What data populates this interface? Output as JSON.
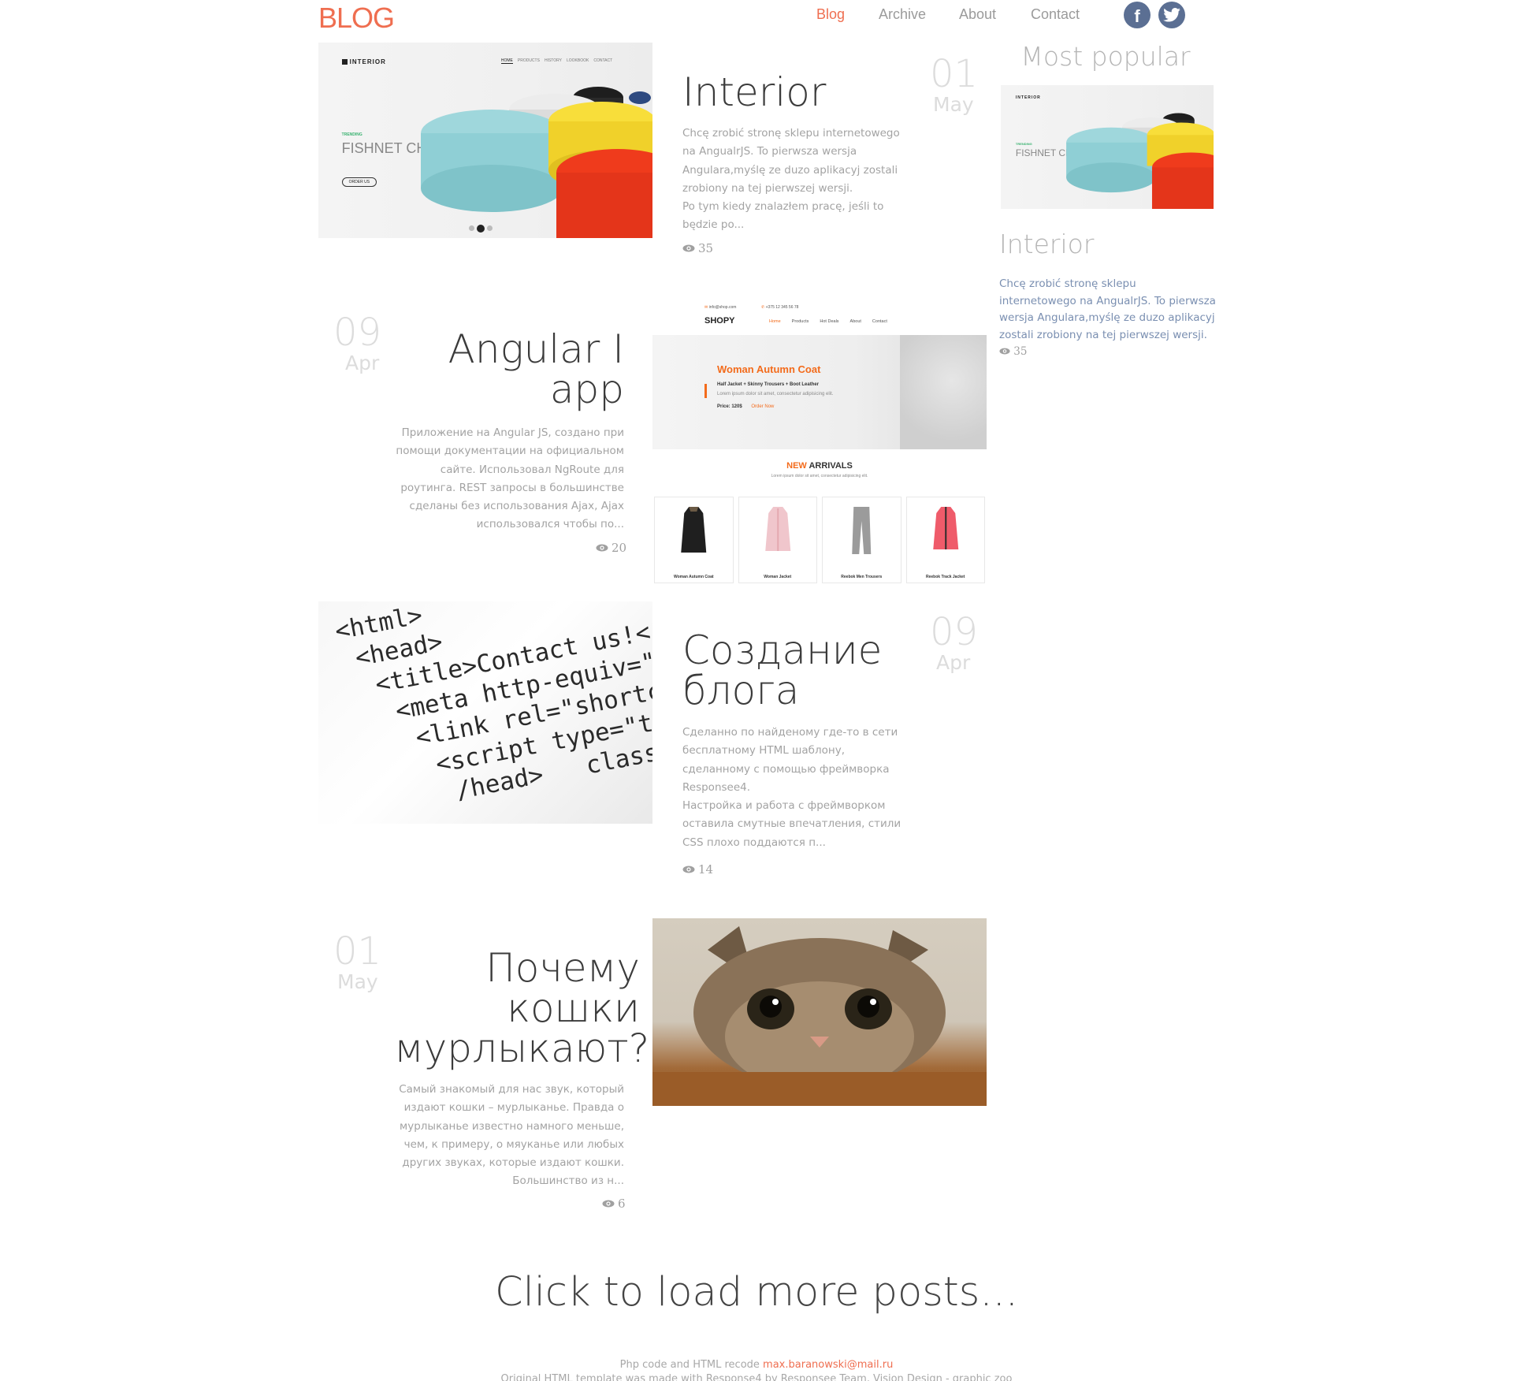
{
  "header": {
    "logo": "BLOG",
    "nav": [
      {
        "label": "Blog",
        "active": true
      },
      {
        "label": "Archive",
        "active": false
      },
      {
        "label": "About",
        "active": false
      },
      {
        "label": "Contact",
        "active": false
      }
    ],
    "social": [
      {
        "icon": "facebook-icon",
        "glyph": "f"
      },
      {
        "icon": "twitter-icon"
      }
    ]
  },
  "posts": [
    {
      "title": "Interior",
      "excerpt": "Chcę zrobić stronę sklepu internetowego na AngualrJS. To pierwsza wersja Angulara,myślę ze duzo aplikacyj zostali zrobiony na tej pierwszej wersji.\nPo tym kiedy znalazłem pracę, jeśli to będzie po...",
      "day": "01",
      "month": "May",
      "views": "35",
      "image": "interior-website-screenshot"
    },
    {
      "title": "Angular I app",
      "excerpt": "Приложение на Angular JS, создано при помощи документации на официальном сайте. Использовал NgRoute для роутинга. REST запросы в большинстве сделаны без использования Ajax, Ajax использовался чтобы по...",
      "day": "09",
      "month": "Apr",
      "views": "20",
      "image": "shop-website-screenshot"
    },
    {
      "title": "Создание блога",
      "excerpt": "Сделанно по найденому где-то в сети бесплатному HTML шаблону, сделанному с помощью фреймворка Responsee4.\nНастройка и работа с фреймворком оставила смутные впечатления, стили CSS плохо поддаются п...",
      "day": "09",
      "month": "Apr",
      "views": "14",
      "image": "html-code-photo"
    },
    {
      "title": "Почему кошки мурлыкают?",
      "excerpt": "Самый знакомый для нас звук, который издают кошки – мурлыканье. Правда о мурлыканье известно намного меньше, чем, к примеру, о мяуканье или любых других звуках, которые издают кошки. Большинство из н...",
      "day": "01",
      "month": "May",
      "views": "6",
      "image": "cat-photo"
    }
  ],
  "interior_mock": {
    "logo": "INTERIOR",
    "nav": [
      "HOME",
      "PRODUCTS",
      "HISTORY",
      "LOOKBOOK",
      "CONTACT"
    ],
    "trending": "TRENDING",
    "hero": "FISHNET CHAIR",
    "order": "ORDER US"
  },
  "shop_mock": {
    "email": "info@shop.com",
    "phone": "+375 12 345 56 78",
    "logo": "SHOPY",
    "nav": [
      "Home",
      "Products",
      "Hot Deals",
      "About",
      "Contact"
    ],
    "hero_title": "Woman Autumn Coat",
    "hero_sub": "Half Jacket + Skinny Trousers + Boot Leather",
    "hero_text": "Lorem ipsum dolor sit amet, consectetur adipisicing elit.",
    "price": "Price: 120$",
    "order": "Order Now",
    "arrivals_new": "NEW",
    "arrivals_rest": " ARRIVALS",
    "arrivals_text": "Lorem ipsum dolor sit amet, consectetur adipisicing elit.",
    "products": [
      "Woman Autumn Coat",
      "Woman Jacket",
      "Reebok Men Trousers",
      "Reebok Track Jacket"
    ]
  },
  "code_mock": {
    "code": "<html>\n <head>\n  <title>Contact us!</t\n   <meta http-equiv=\"C\n    <link rel=\"shortcu\n     <script type=\"tex\n      /head>   class=\"h"
  },
  "sidebar": {
    "heading": "Most popular",
    "title": "Interior",
    "excerpt": "Chcę zrobić stronę sklepu internetowego na AngualrJS. To pierwsza wersja Angulara,myślę ze duzo aplikacyj zostali zrobiony na tej pierwszej wersji.",
    "views": "35"
  },
  "load_more": "Click to load more posts...",
  "footer": {
    "line1_prefix": "Php code and HTML recode ",
    "email": "max.baranowski@mail.ru",
    "line2": "Original HTML template was made with Response4 by Responsee Team, Vision Design - graphic zoo"
  },
  "colors": {
    "accent": "#ef6e50",
    "social": "#5b6f93",
    "sidebar_text": "#7a8fb1"
  }
}
